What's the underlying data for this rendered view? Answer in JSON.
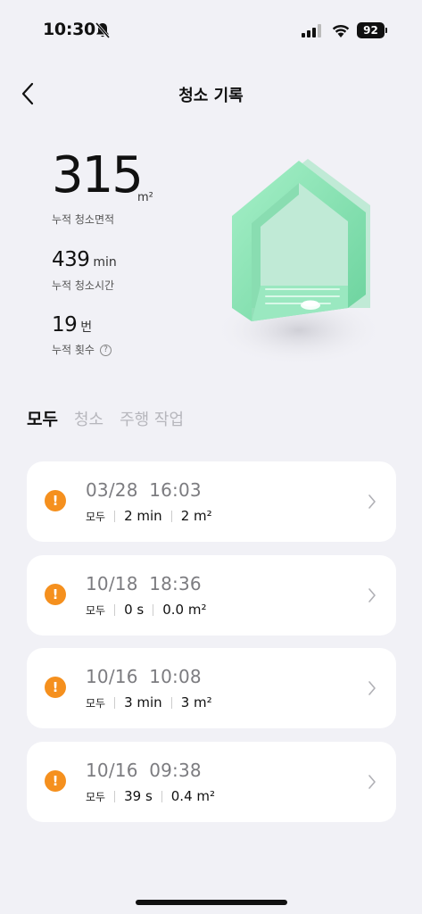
{
  "status_bar": {
    "time": "10:30",
    "battery": "92",
    "icons": [
      "bell-off-icon",
      "signal-icon",
      "wifi-icon",
      "battery-icon"
    ]
  },
  "header": {
    "title": "청소 기록",
    "back_icon": "chevron-left-icon"
  },
  "stats": {
    "area_value": "315",
    "area_unit": "m²",
    "area_label": "누적 청소면적",
    "time_value": "439",
    "time_unit": "min",
    "time_label": "누적 청소시간",
    "count_value": "19",
    "count_unit": "번",
    "count_label": "누적 횟수",
    "info_icon": "?"
  },
  "tabs": [
    {
      "label": "모두",
      "active": true
    },
    {
      "label": "청소",
      "active": false
    },
    {
      "label": "주행 작업",
      "active": false
    }
  ],
  "records": [
    {
      "date": "03/28  16:03",
      "mode": "모두",
      "duration": "2 min",
      "area": "2 m²"
    },
    {
      "date": "10/18  18:36",
      "mode": "모두",
      "duration": "0 s",
      "area": "0.0 m²"
    },
    {
      "date": "10/16  10:08",
      "mode": "모두",
      "duration": "3 min",
      "area": "3 m²"
    },
    {
      "date": "10/16  09:38",
      "mode": "모두",
      "duration": "39 s",
      "area": "0.4 m²"
    }
  ],
  "colors": {
    "background": "#f1f1f6",
    "warning": "#f5901e",
    "house_green": "#8fe3b6"
  }
}
